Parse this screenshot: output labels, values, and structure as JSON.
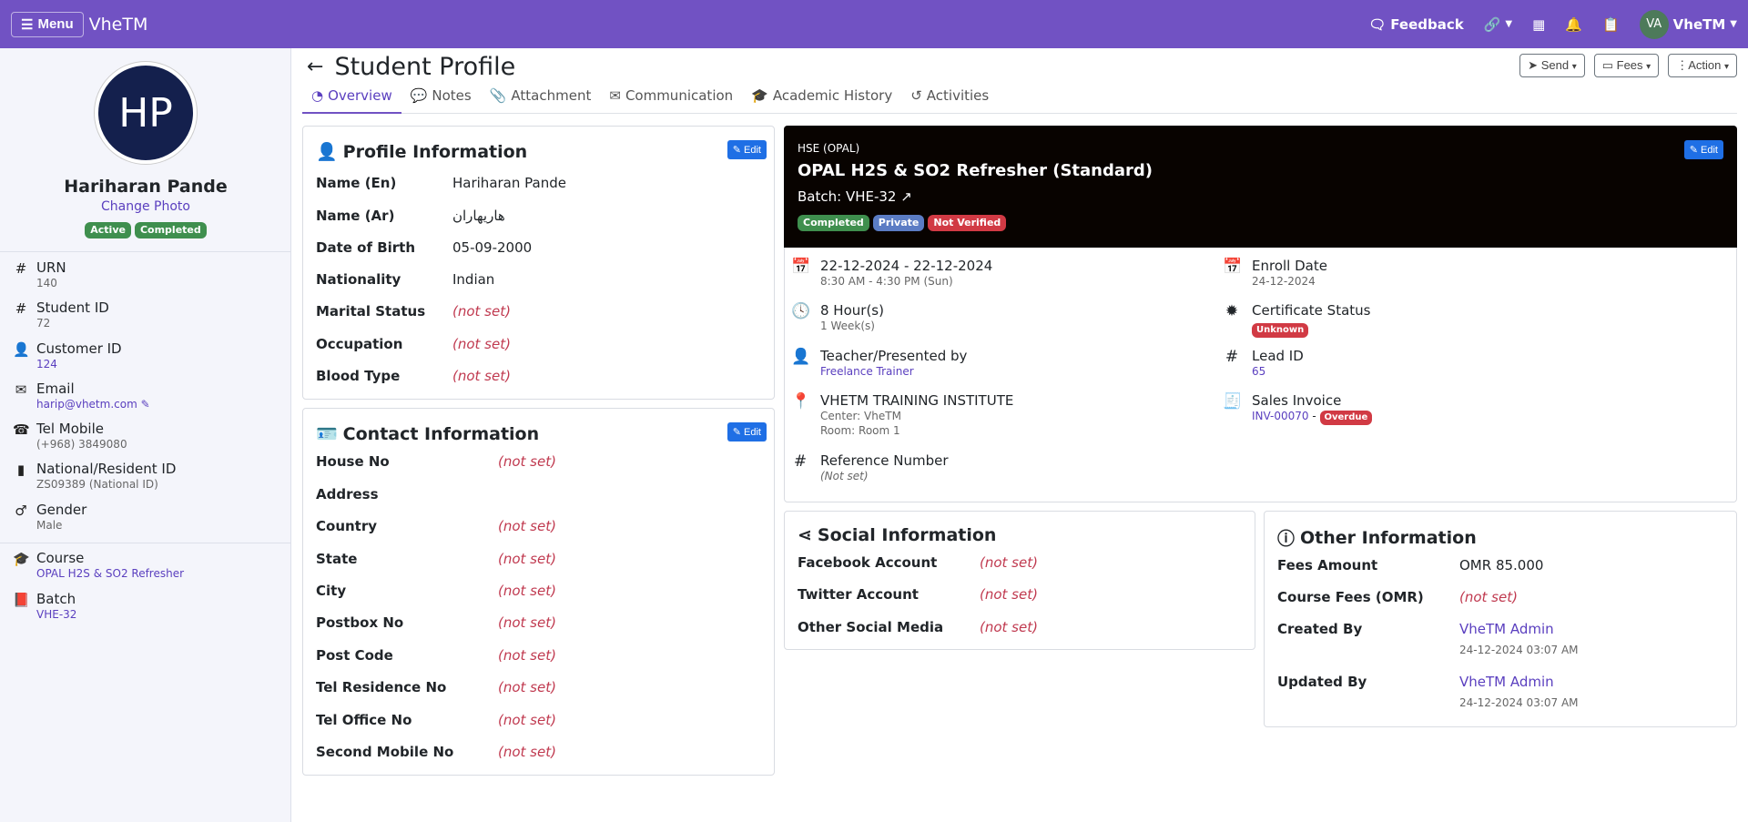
{
  "topbar": {
    "menu_label": "Menu",
    "brand": "VheTM",
    "feedback": "Feedback",
    "user_initials": "VA",
    "user_name": "VheTM"
  },
  "sidebar": {
    "initials": "HP",
    "name": "Hariharan Pande",
    "change_photo": "Change Photo",
    "badges": [
      "Active",
      "Completed"
    ],
    "fields": [
      {
        "label": "URN",
        "value": "140"
      },
      {
        "label": "Student ID",
        "value": "72"
      },
      {
        "label": "Customer ID",
        "value": "124"
      },
      {
        "label": "Email",
        "value": "harip@vhetm.com"
      },
      {
        "label": "Tel Mobile",
        "value": "(+968) 3849080"
      },
      {
        "label": "National/Resident ID",
        "value": "ZS09389 (National ID)"
      },
      {
        "label": "Gender",
        "value": "Male"
      },
      {
        "label": "Course",
        "value": "OPAL H2S & SO2 Refresher"
      },
      {
        "label": "Batch",
        "value": "VHE-32"
      }
    ]
  },
  "header": {
    "title": "Student Profile",
    "buttons": [
      "Send",
      "Fees",
      "Action"
    ]
  },
  "tabs": [
    "Overview",
    "Notes",
    "Attachment",
    "Communication",
    "Academic History",
    "Activities"
  ],
  "edit_label": "Edit",
  "profile": {
    "title": "Profile Information",
    "rows": [
      {
        "label": "Name (En)",
        "value": "Hariharan Pande"
      },
      {
        "label": "Name (Ar)",
        "value": "هاريهاران"
      },
      {
        "label": "Date of Birth",
        "value": "05-09-2000"
      },
      {
        "label": "Nationality",
        "value": "Indian"
      },
      {
        "label": "Marital Status",
        "value": "(not set)"
      },
      {
        "label": "Occupation",
        "value": "(not set)"
      },
      {
        "label": "Blood Type",
        "value": "(not set)"
      }
    ]
  },
  "contact": {
    "title": "Contact Information",
    "rows": [
      {
        "label": "House No",
        "value": "(not set)"
      },
      {
        "label": "Address",
        "value": ""
      },
      {
        "label": "Country",
        "value": "(not set)"
      },
      {
        "label": "State",
        "value": "(not set)"
      },
      {
        "label": "City",
        "value": "(not set)"
      },
      {
        "label": "Postbox No",
        "value": "(not set)"
      },
      {
        "label": "Post Code",
        "value": "(not set)"
      },
      {
        "label": "Tel Residence No",
        "value": "(not set)"
      },
      {
        "label": "Tel Office No",
        "value": "(not set)"
      },
      {
        "label": "Second Mobile No",
        "value": "(not set)"
      }
    ]
  },
  "course": {
    "category": "HSE (OPAL)",
    "title": "OPAL H2S & SO2 Refresher (Standard)",
    "batch": "Batch: VHE-32",
    "badges": [
      "Completed",
      "Private",
      "Not Verified"
    ],
    "dates": "22-12-2024 - 22-12-2024",
    "time": "8:30 AM - 4:30 PM (Sun)",
    "hours": "8 Hour(s)",
    "weeks": "1 Week(s)",
    "teacher_label": "Teacher/Presented by",
    "teacher": "Freelance Trainer",
    "institute": "VHETM TRAINING INSTITUTE",
    "center": "Center: VheTM",
    "room": "Room: Room 1",
    "ref_label": "Reference Number",
    "ref_value": "(Not set)",
    "enroll_label": "Enroll Date",
    "enroll_value": "24-12-2024",
    "cert_label": "Certificate Status",
    "cert_value": "Unknown",
    "lead_label": "Lead ID",
    "lead_value": "65",
    "invoice_label": "Sales Invoice",
    "invoice_value": "INV-00070",
    "invoice_sep": " - ",
    "invoice_status": "Overdue"
  },
  "social": {
    "title": "Social Information",
    "rows": [
      {
        "label": "Facebook Account",
        "value": "(not set)"
      },
      {
        "label": "Twitter Account",
        "value": "(not set)"
      },
      {
        "label": "Other Social Media",
        "value": "(not set)"
      }
    ]
  },
  "other": {
    "title": "Other Information",
    "fees_label": "Fees Amount",
    "fees_value": "OMR 85.000",
    "course_fees_label": "Course Fees (OMR)",
    "course_fees_value": "(not set)",
    "created_label": "Created By",
    "created_value": "VheTM Admin",
    "created_time": "24-12-2024 03:07 AM",
    "updated_label": "Updated By",
    "updated_value": "VheTM Admin",
    "updated_time": "24-12-2024 03:07 AM"
  },
  "colors": {
    "topbar": "#7152c3",
    "accent": "#5a3fbf",
    "edit": "#1f6fe5",
    "notset": "#c0394f"
  }
}
